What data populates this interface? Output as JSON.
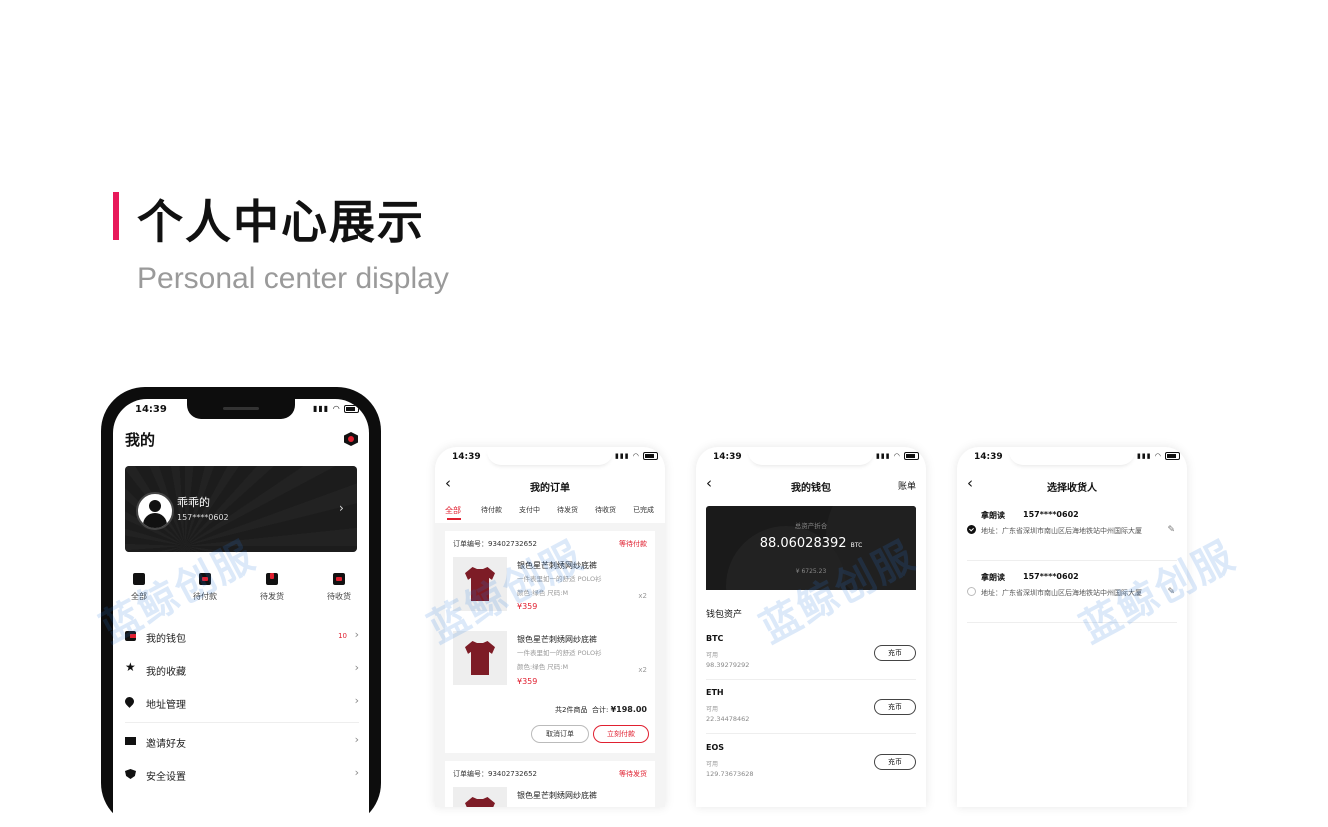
{
  "header": {
    "title_cn": "个人中心展示",
    "title_en": "Personal center display"
  },
  "watermark": "蓝鲸创服",
  "phone_mine": {
    "time": "14:39",
    "title": "我的",
    "settings_icon": "hexagon-settings-icon",
    "profile": {
      "name": "乖乖的",
      "phone": "157****0602"
    },
    "order_tabs": [
      {
        "label": "全部",
        "icon": "all-orders-icon"
      },
      {
        "label": "待付款",
        "icon": "wallet-icon"
      },
      {
        "label": "待发货",
        "icon": "package-icon"
      },
      {
        "label": "待收货",
        "icon": "truck-icon"
      }
    ],
    "menu": [
      {
        "label": "我的钱包",
        "icon": "wallet-icon",
        "count": "10"
      },
      {
        "label": "我的收藏",
        "icon": "star-icon"
      },
      {
        "label": "地址管理",
        "icon": "location-icon"
      },
      {
        "label": "邀请好友",
        "icon": "mail-icon"
      },
      {
        "label": "安全设置",
        "icon": "shield-icon"
      }
    ]
  },
  "phone_orders": {
    "time": "14:39",
    "title": "我的订单",
    "tabs": [
      "全部",
      "待付款",
      "支付中",
      "待发货",
      "待收货",
      "已完成"
    ],
    "orders": [
      {
        "number_label": "订单编号：93402732652",
        "status": "等待付款",
        "items": [
          {
            "name": "银色星芒刺绣网纱底裤",
            "desc": "一件表里如一的舒适 POLO衫",
            "spec": "颜色:绿色  尺码:M",
            "price": "¥359",
            "qty": "x2"
          },
          {
            "name": "银色星芒刺绣网纱底裤",
            "desc": "一件表里如一的舒适 POLO衫",
            "spec": "颜色:绿色  尺码:M",
            "price": "¥359",
            "qty": "x2"
          }
        ],
        "summary_count": "共2件商品",
        "summary_total_label": "合计:",
        "summary_total": "¥198.00",
        "cancel_label": "取消订单",
        "pay_label": "立刻付款"
      },
      {
        "number_label": "订单编号：93402732652",
        "status": "等待发货",
        "items": [
          {
            "name": "银色星芒刺绣网纱底裤"
          }
        ]
      }
    ]
  },
  "phone_wallet": {
    "time": "14:39",
    "title": "我的钱包",
    "bill_link": "账单",
    "total_label": "总资产折合",
    "total_amount": "88.06028392",
    "total_unit": "BTC",
    "total_cny": "¥ 6725.23",
    "section_title": "钱包资产",
    "coins": [
      {
        "name": "BTC",
        "avail_label": "可用",
        "value": "98.39279292",
        "button": "充币"
      },
      {
        "name": "ETH",
        "avail_label": "可用",
        "value": "22.34478462",
        "button": "充币"
      },
      {
        "name": "EOS",
        "avail_label": "可用",
        "value": "129.73673628",
        "button": "充币"
      }
    ]
  },
  "phone_address": {
    "time": "14:39",
    "title": "选择收货人",
    "addresses": [
      {
        "name": "拿朗读",
        "phone": "157****0602",
        "address": "地址：广东省深圳市南山区后海地铁站中州国际大厦",
        "selected": true
      },
      {
        "name": "拿朗读",
        "phone": "157****0602",
        "address": "地址：广东省深圳市南山区后海地铁站中州国际大厦",
        "selected": false
      }
    ]
  }
}
